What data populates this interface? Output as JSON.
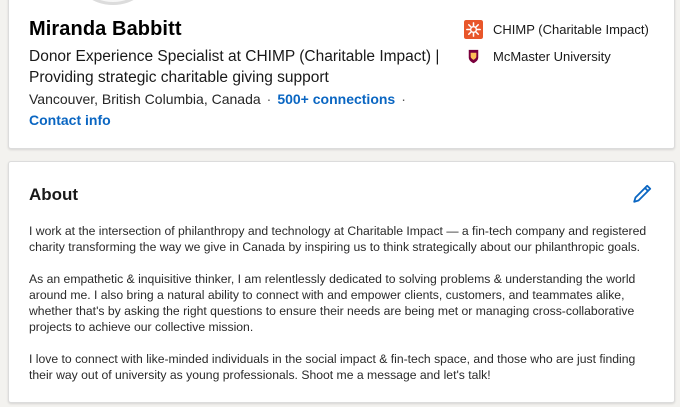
{
  "profile": {
    "name": "Miranda Babbitt",
    "headline": "Donor Experience Specialist at CHIMP (Charitable Impact) | Providing strategic charitable giving support",
    "location": "Vancouver, British Columbia, Canada",
    "connections": "500+ connections",
    "separator": "·",
    "contact_info": "Contact info",
    "organizations": [
      {
        "name": "CHIMP (Charitable Impact)",
        "icon": "chimp-logo-icon",
        "color": "#e8562a"
      },
      {
        "name": "McMaster University",
        "icon": "mcmaster-crest-icon",
        "color": "#7a003c"
      }
    ]
  },
  "about": {
    "title": "About",
    "edit_icon": "pencil-icon",
    "paragraphs": [
      "I work at the intersection of philanthropy and technology at Charitable Impact — a fin-tech company and registered charity transforming the way we give in Canada by inspiring us to think strategically about our philanthropic goals.",
      "As an empathetic & inquisitive thinker, I am relentlessly dedicated to solving problems & understanding the world around me. I also bring a natural ability to connect with and empower clients, customers, and teammates alike, whether that's by asking the right questions to ensure their needs are being met or managing cross-collaborative projects to achieve our collective mission.",
      "I love to connect with like-minded individuals in the social impact & fin-tech space, and those who are just finding their way out of university as young professionals. Shoot me a message and let's talk!"
    ]
  },
  "colors": {
    "link": "#0a66c2",
    "background": "#f3f2ef",
    "card": "#ffffff"
  }
}
